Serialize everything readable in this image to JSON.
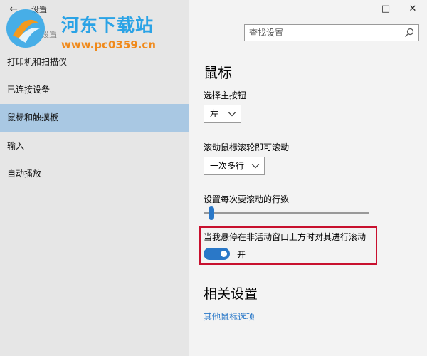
{
  "window": {
    "title": "设置",
    "back_glyph": "←",
    "minimize_glyph": "—",
    "maximize_glyph": "□",
    "close_glyph": "✕"
  },
  "watermark": {
    "name": "河东下载站",
    "url": "www.pc0359.cn",
    "settings_text": "设置"
  },
  "search": {
    "placeholder": "查找设置"
  },
  "sidebar": {
    "items": [
      {
        "label": "打印机和扫描仪"
      },
      {
        "label": "已连接设备"
      },
      {
        "label": "鼠标和触摸板",
        "selected": true
      },
      {
        "label": "输入"
      },
      {
        "label": "自动播放"
      }
    ]
  },
  "main": {
    "heading": "鼠标",
    "primary_button": {
      "label": "选择主按钮",
      "value": "左"
    },
    "wheel_scroll": {
      "label": "滚动鼠标滚轮即可滚动",
      "value": "一次多行"
    },
    "lines_to_scroll": {
      "label": "设置每次要滚动的行数",
      "value_fraction": 0.03
    },
    "inactive_scroll": {
      "label": "当我悬停在非活动窗口上方时对其进行滚动",
      "toggle_state": "开",
      "on": true
    },
    "related": {
      "title": "相关设置",
      "link": "其他鼠标选项"
    }
  },
  "colors": {
    "accent": "#2a78c8",
    "highlight_border": "#c8102e",
    "sidebar_bg": "#e6e6e6",
    "sidebar_selected": "#a9c8e3",
    "content_bg": "#f3f3f3"
  }
}
